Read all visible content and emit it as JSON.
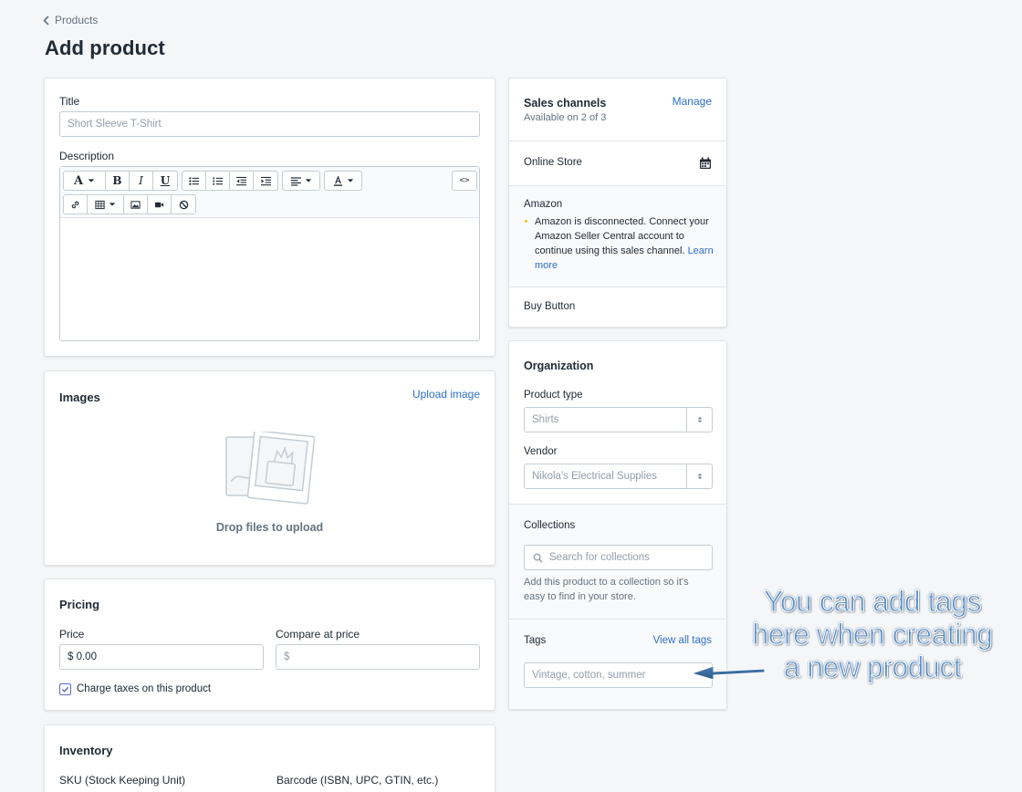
{
  "breadcrumb": {
    "label": "Products"
  },
  "page": {
    "title": "Add product"
  },
  "product": {
    "title_label": "Title",
    "title_placeholder": "Short Sleeve T-Shirt",
    "description_label": "Description"
  },
  "editor": {
    "toolbar_row1": [
      "text-style-dropdown",
      "bold-icon",
      "italic-icon",
      "underline-icon",
      "bullet-list-icon",
      "numbered-list-icon",
      "outdent-icon",
      "indent-icon",
      "align-dropdown",
      "text-color-dropdown",
      "code-view-icon"
    ],
    "toolbar_row2": [
      "link-icon",
      "table-dropdown",
      "image-icon",
      "video-icon",
      "clear-format-icon"
    ],
    "text_style_label": "A",
    "bold_label": "B",
    "italic_label": "I",
    "underline_label": "U",
    "code_label": "<>"
  },
  "images": {
    "heading": "Images",
    "upload_link": "Upload image",
    "drop_text": "Drop files to upload"
  },
  "pricing": {
    "heading": "Pricing",
    "price_label": "Price",
    "price_value": "$ 0.00",
    "compare_label": "Compare at price",
    "compare_placeholder": "$",
    "tax_label": "Charge taxes on this product",
    "tax_checked": true
  },
  "inventory": {
    "heading": "Inventory",
    "sku_label": "SKU (Stock Keeping Unit)",
    "barcode_label": "Barcode (ISBN, UPC, GTIN, etc.)"
  },
  "sales_channels": {
    "heading": "Sales channels",
    "subheading": "Available on 2 of 3",
    "manage_link": "Manage",
    "online_store": "Online Store",
    "amazon": "Amazon",
    "amazon_warning": "Amazon is disconnected. Connect your Amazon Seller Central account to continue using this sales channel.",
    "learn_more": "Learn more",
    "buy_button": "Buy Button"
  },
  "organization": {
    "heading": "Organization",
    "product_type_label": "Product type",
    "product_type_placeholder": "Shirts",
    "vendor_label": "Vendor",
    "vendor_placeholder": "Nikola's Electrical Supplies",
    "collections_label": "Collections",
    "collections_placeholder": "Search for collections",
    "collections_help": "Add this product to a collection so it's easy to find in your store.",
    "tags_label": "Tags",
    "tags_link": "View all tags",
    "tags_placeholder": "Vintage, cotton, summer"
  },
  "annotation": {
    "line1": "You can add tags",
    "line2": "here when creating",
    "line3": "a new product",
    "color": "#5b8fc7"
  },
  "colors": {
    "link": "#2c6ecb",
    "background": "#f4f6f8",
    "warning_dot": "#eec200"
  }
}
